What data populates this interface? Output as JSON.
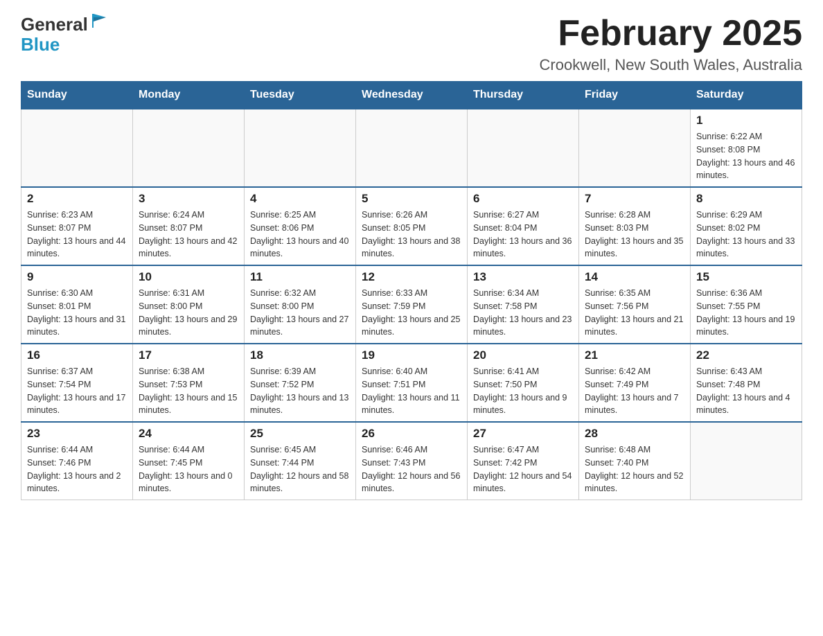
{
  "header": {
    "logo_general": "General",
    "logo_blue": "Blue",
    "month_title": "February 2025",
    "location": "Crookwell, New South Wales, Australia"
  },
  "days_of_week": [
    "Sunday",
    "Monday",
    "Tuesday",
    "Wednesday",
    "Thursday",
    "Friday",
    "Saturday"
  ],
  "weeks": [
    [
      {
        "day": "",
        "info": ""
      },
      {
        "day": "",
        "info": ""
      },
      {
        "day": "",
        "info": ""
      },
      {
        "day": "",
        "info": ""
      },
      {
        "day": "",
        "info": ""
      },
      {
        "day": "",
        "info": ""
      },
      {
        "day": "1",
        "info": "Sunrise: 6:22 AM\nSunset: 8:08 PM\nDaylight: 13 hours and 46 minutes."
      }
    ],
    [
      {
        "day": "2",
        "info": "Sunrise: 6:23 AM\nSunset: 8:07 PM\nDaylight: 13 hours and 44 minutes."
      },
      {
        "day": "3",
        "info": "Sunrise: 6:24 AM\nSunset: 8:07 PM\nDaylight: 13 hours and 42 minutes."
      },
      {
        "day": "4",
        "info": "Sunrise: 6:25 AM\nSunset: 8:06 PM\nDaylight: 13 hours and 40 minutes."
      },
      {
        "day": "5",
        "info": "Sunrise: 6:26 AM\nSunset: 8:05 PM\nDaylight: 13 hours and 38 minutes."
      },
      {
        "day": "6",
        "info": "Sunrise: 6:27 AM\nSunset: 8:04 PM\nDaylight: 13 hours and 36 minutes."
      },
      {
        "day": "7",
        "info": "Sunrise: 6:28 AM\nSunset: 8:03 PM\nDaylight: 13 hours and 35 minutes."
      },
      {
        "day": "8",
        "info": "Sunrise: 6:29 AM\nSunset: 8:02 PM\nDaylight: 13 hours and 33 minutes."
      }
    ],
    [
      {
        "day": "9",
        "info": "Sunrise: 6:30 AM\nSunset: 8:01 PM\nDaylight: 13 hours and 31 minutes."
      },
      {
        "day": "10",
        "info": "Sunrise: 6:31 AM\nSunset: 8:00 PM\nDaylight: 13 hours and 29 minutes."
      },
      {
        "day": "11",
        "info": "Sunrise: 6:32 AM\nSunset: 8:00 PM\nDaylight: 13 hours and 27 minutes."
      },
      {
        "day": "12",
        "info": "Sunrise: 6:33 AM\nSunset: 7:59 PM\nDaylight: 13 hours and 25 minutes."
      },
      {
        "day": "13",
        "info": "Sunrise: 6:34 AM\nSunset: 7:58 PM\nDaylight: 13 hours and 23 minutes."
      },
      {
        "day": "14",
        "info": "Sunrise: 6:35 AM\nSunset: 7:56 PM\nDaylight: 13 hours and 21 minutes."
      },
      {
        "day": "15",
        "info": "Sunrise: 6:36 AM\nSunset: 7:55 PM\nDaylight: 13 hours and 19 minutes."
      }
    ],
    [
      {
        "day": "16",
        "info": "Sunrise: 6:37 AM\nSunset: 7:54 PM\nDaylight: 13 hours and 17 minutes."
      },
      {
        "day": "17",
        "info": "Sunrise: 6:38 AM\nSunset: 7:53 PM\nDaylight: 13 hours and 15 minutes."
      },
      {
        "day": "18",
        "info": "Sunrise: 6:39 AM\nSunset: 7:52 PM\nDaylight: 13 hours and 13 minutes."
      },
      {
        "day": "19",
        "info": "Sunrise: 6:40 AM\nSunset: 7:51 PM\nDaylight: 13 hours and 11 minutes."
      },
      {
        "day": "20",
        "info": "Sunrise: 6:41 AM\nSunset: 7:50 PM\nDaylight: 13 hours and 9 minutes."
      },
      {
        "day": "21",
        "info": "Sunrise: 6:42 AM\nSunset: 7:49 PM\nDaylight: 13 hours and 7 minutes."
      },
      {
        "day": "22",
        "info": "Sunrise: 6:43 AM\nSunset: 7:48 PM\nDaylight: 13 hours and 4 minutes."
      }
    ],
    [
      {
        "day": "23",
        "info": "Sunrise: 6:44 AM\nSunset: 7:46 PM\nDaylight: 13 hours and 2 minutes."
      },
      {
        "day": "24",
        "info": "Sunrise: 6:44 AM\nSunset: 7:45 PM\nDaylight: 13 hours and 0 minutes."
      },
      {
        "day": "25",
        "info": "Sunrise: 6:45 AM\nSunset: 7:44 PM\nDaylight: 12 hours and 58 minutes."
      },
      {
        "day": "26",
        "info": "Sunrise: 6:46 AM\nSunset: 7:43 PM\nDaylight: 12 hours and 56 minutes."
      },
      {
        "day": "27",
        "info": "Sunrise: 6:47 AM\nSunset: 7:42 PM\nDaylight: 12 hours and 54 minutes."
      },
      {
        "day": "28",
        "info": "Sunrise: 6:48 AM\nSunset: 7:40 PM\nDaylight: 12 hours and 52 minutes."
      },
      {
        "day": "",
        "info": ""
      }
    ]
  ]
}
